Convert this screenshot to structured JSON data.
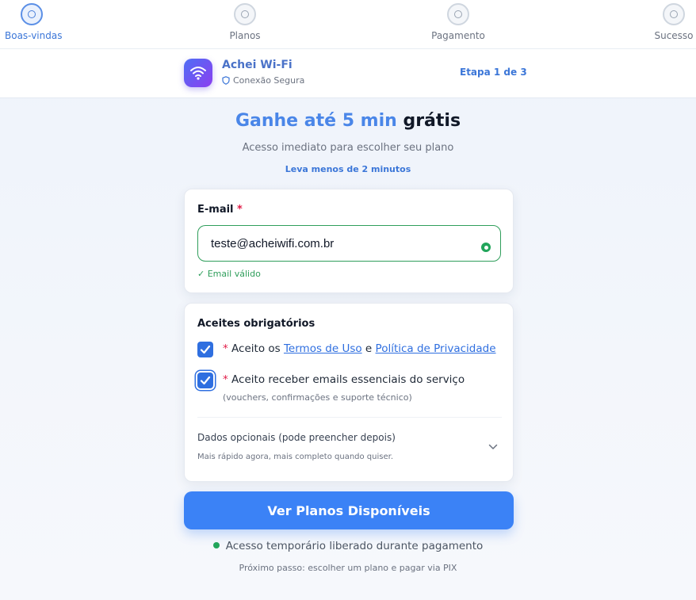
{
  "stepper": {
    "steps": [
      {
        "label": "Boas-vindas",
        "active": true
      },
      {
        "label": "Planos",
        "active": false
      },
      {
        "label": "Pagamento",
        "active": false
      },
      {
        "label": "Sucesso",
        "active": false
      }
    ]
  },
  "header": {
    "app_name": "Achei Wi-Fi",
    "secure_label": "Conexão Segura",
    "step_count": "Etapa 1 de 3",
    "icon": "wifi-icon"
  },
  "hero": {
    "title_accent": "Ganhe até 5 min",
    "title_rest": "grátis",
    "subtitle": "Acesso imediato para escolher seu plano",
    "hint": "Leva menos de 2 minutos"
  },
  "email_form": {
    "label": "E-mail",
    "required_mark": "*",
    "value": "teste@acheiwifi.com.br",
    "valid_message": "✓ Email válido"
  },
  "consents": {
    "title": "Aceites obrigatórios",
    "terms": {
      "required_mark": "*",
      "prefix": "Aceito os",
      "terms_link": "Termos de Uso",
      "conjunction": "e",
      "privacy_link": "Política de Privacidade",
      "checked": true
    },
    "emails": {
      "required_mark": "*",
      "text": "Aceito receber emails essenciais do serviço",
      "sub": "(vouchers, confirmações e suporte técnico)",
      "checked": true
    },
    "optional": {
      "title": "Dados opcionais (pode preencher depois)",
      "sub": "Mais rápido agora, mais completo quando quiser."
    }
  },
  "cta": {
    "label": "Ver Planos Disponíveis"
  },
  "status": {
    "message": "Acesso temporário liberado durante pagamento",
    "next_step": "Próximo passo: escolher um plano e pagar via PIX"
  },
  "colors": {
    "accent": "#3b82f6",
    "brand_gradient_start": "#4f6ef5",
    "brand_gradient_end": "#8b3ff0",
    "success": "#22a55b",
    "required": "#e11d48"
  }
}
